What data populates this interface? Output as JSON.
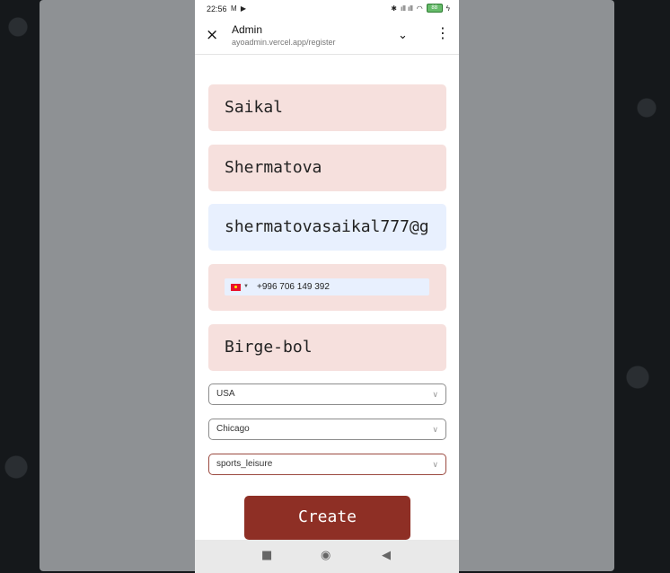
{
  "status_bar": {
    "time": "22:56",
    "left_icons": "M ▶",
    "signal": "ıll ıll",
    "battery": "88"
  },
  "app_bar": {
    "title": "Admin",
    "url": "ayoadmin.vercel.app/register",
    "close_icon": "×",
    "expand_icon": "⌄",
    "menu_icon": "⋮"
  },
  "form": {
    "first_name": "Saikal",
    "last_name": "Shermatova",
    "email": "shermatovasaikal777@g",
    "phone": {
      "country_caret": "▼",
      "number": "+996 706 149 392"
    },
    "company": "Birge-bol",
    "country": "USA",
    "city": "Chicago",
    "category": "sports_leisure",
    "submit_label": "Create"
  },
  "nav_bar": {
    "recents": "■",
    "home": "◉",
    "back": "◀"
  },
  "colors": {
    "field_bg": "#f6e0dd",
    "autofill_bg": "#e8f0fe",
    "button_bg": "#8e2f25"
  }
}
